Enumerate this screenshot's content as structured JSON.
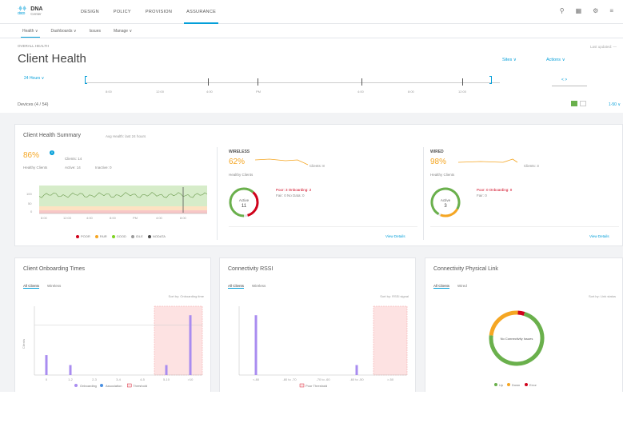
{
  "nav": {
    "brand_top": "·ı|ı·ı|ı·",
    "brand_cisco": "cisco",
    "brand_dna": "DNA",
    "brand_center": "Center",
    "items": [
      {
        "label": "DESIGN"
      },
      {
        "label": "POLICY"
      },
      {
        "label": "PROVISION"
      },
      {
        "label": "ASSURANCE"
      }
    ],
    "icons": [
      "search-icon",
      "grid-icon",
      "gear-icon",
      "menu-icon"
    ]
  },
  "subnav": {
    "items": [
      {
        "label": "Health ∨"
      },
      {
        "label": "Dashboards ∨"
      },
      {
        "label": "Issues"
      },
      {
        "label": "Manage ∨"
      }
    ]
  },
  "header": {
    "breadcrumb": "OVERALL HEALTH",
    "title": "Client Health",
    "last_updated": "Last updated: —",
    "sites_button": "Sites ∨",
    "actions_button": "Actions ∨",
    "timeline_label": "24 Hours ∨",
    "timeline_times": [
      "8:00",
      "12:00",
      "4:00",
      "PM",
      "4:00",
      "8:00",
      "12:00"
    ],
    "mini_range": "< >",
    "devices_label": "Devices (4 / 54)",
    "more_link": "1-50 ∨"
  },
  "summary": {
    "title": "Client Health Summary",
    "subtitle": "Avg Health: last 24 hours",
    "overall": {
      "pct": "86%",
      "health_label": "Healthy Clients",
      "active_label": "Active: 14",
      "inactive_label": "Inactive: 0",
      "stat_label": "Clients: 14",
      "legend": [
        {
          "label": "POOR",
          "color": "#d0021b"
        },
        {
          "label": "FAIR",
          "color": "#f5a623"
        },
        {
          "label": "GOOD",
          "color": "#7ed321"
        },
        {
          "label": "IDLE",
          "color": "#9b9b9b"
        },
        {
          "label": "NODATA",
          "color": "#4a4a4a"
        }
      ]
    },
    "wireless": {
      "label": "WIRELESS",
      "pct": "62%",
      "health_label": "Healthy Clients",
      "count_label": "Clients: 8",
      "donut_top": "Active",
      "donut_num": "11",
      "detail_1": "Poor: 3  Onboarding: 2",
      "detail_2": "Fair: 0  No Data: 0",
      "link": "View Details"
    },
    "wired": {
      "label": "WIRED",
      "pct": "98%",
      "health_label": "Healthy Clients",
      "count_label": "Clients: 3",
      "donut_top": "Active",
      "donut_num": "3",
      "detail_1": "Poor: 0  Onboarding: 0",
      "detail_2": "Fair: 0",
      "link": "View Details"
    }
  },
  "cards": [
    {
      "title": "Client Onboarding Times",
      "tab_active": "All Clients",
      "tab_other": "Wireless",
      "note": "Sort by: Onboarding time"
    },
    {
      "title": "Connectivity RSSI",
      "tab_active": "All Clients",
      "tab_other": "Wireless",
      "note": "Sort by: RSSI signal"
    },
    {
      "title": "Connectivity Physical Link",
      "tab_active": "All Clients",
      "tab_other": "Wired",
      "note": "Sort by: Link status",
      "center_text": "No Connectivity Issues"
    }
  ],
  "chart_data": [
    {
      "type": "bar",
      "title": "Client Onboarding Times",
      "categories": [
        "0",
        "1-2",
        "2-3",
        "3-4",
        "4-5",
        "5-10",
        ">10"
      ],
      "values": [
        2,
        1,
        0,
        0,
        0,
        1,
        6
      ],
      "xlabel": "",
      "ylabel": "Clients",
      "legend": [
        "Onboarding",
        "Association",
        "Threshold"
      ],
      "highlight_range": [
        ">5"
      ]
    },
    {
      "type": "bar",
      "title": "Connectivity RSSI",
      "categories": [
        "<-80",
        "-80 to -70",
        "-70 to -60",
        "-60 to -50",
        ">-50"
      ],
      "values": [
        6,
        0,
        0,
        1,
        0
      ],
      "ylabel": "",
      "legend": [
        "Poor Threshold"
      ]
    },
    {
      "type": "pie",
      "title": "Connectivity Physical Link",
      "labels": [
        "Up",
        "Down",
        "Error"
      ],
      "values": [
        72,
        24,
        4
      ],
      "colors": [
        "#6ab04c",
        "#f5a623",
        "#d0021b"
      ]
    }
  ]
}
